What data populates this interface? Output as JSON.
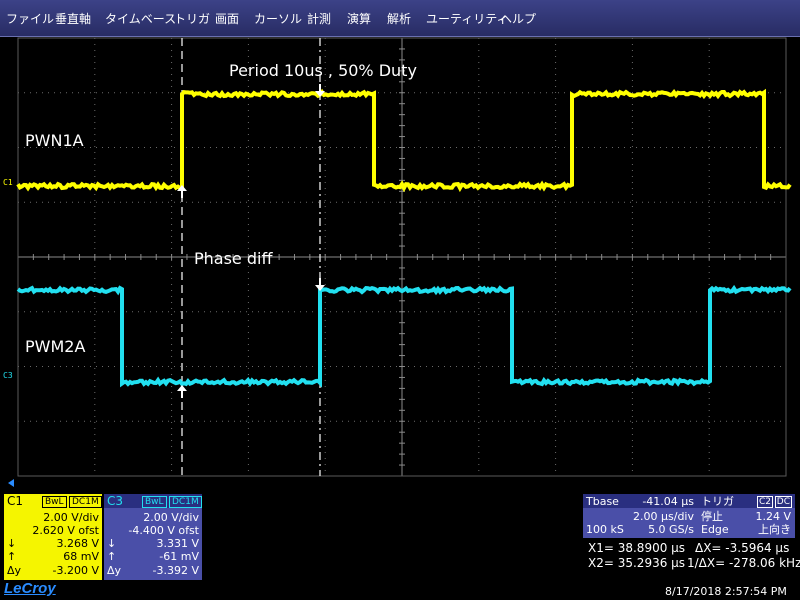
{
  "menu": [
    "ファイル",
    "垂直軸",
    "タイムベース",
    "トリガ",
    "画面",
    "カーソル",
    "計測",
    "演算",
    "解析",
    "ユーティリティ",
    "ヘルプ"
  ],
  "annotations": {
    "period": "Period 10us , 50% Duty",
    "phase": "Phase diff",
    "trace1": "PWN1A",
    "trace2": "PWM2A"
  },
  "ch_tags": {
    "c1": "C1",
    "c3": "C3"
  },
  "colors": {
    "ch1": "#ffff00",
    "ch3": "#22e0f0",
    "grid": "#6a6a6a",
    "panel": "#4a4fa8",
    "c1_panel": "#f5f500",
    "logo": "#2a8cff"
  },
  "ch1": {
    "title": "C1",
    "tag_bw": "BwL",
    "tag_dc": "DC1M",
    "vdiv": "2.00 V/div",
    "offset": "2.620 V ofst",
    "down_sym": "↓",
    "down_val": "3.268 V",
    "up_sym": "↑",
    "up_val": "68 mV",
    "dy_sym": "Δy",
    "dy_val": "-3.200 V"
  },
  "ch3": {
    "title": "C3",
    "tag_bw": "BwL",
    "tag_dc": "DC1M",
    "vdiv": "2.00 V/div",
    "offset": "-4.400 V ofst",
    "down_sym": "↓",
    "down_val": "3.331 V",
    "up_sym": "↑",
    "up_val": "-61 mV",
    "dy_sym": "Δy",
    "dy_val": "-3.392 V"
  },
  "timebase": {
    "label": "Tbase",
    "offset": "-41.04 µs",
    "div": "2.00 µs/div",
    "samples": "100 kS",
    "rate": "5.0 GS/s"
  },
  "trigger": {
    "label": "トリガ",
    "tag": "C2",
    "coupling": "DC",
    "mode": "停止",
    "level": "1.24 V",
    "type": "Edge",
    "slope": "上向き"
  },
  "cursors": {
    "x1": "X1=  38.8900 µs",
    "dx": "ΔX=    -3.5964 µs",
    "x2": "X2=  35.2936 µs",
    "inv_dx": "1/ΔX=  -278.06 kHz"
  },
  "logo": "LeCroy",
  "datetime": "8/17/2018 2:57:54 PM"
}
